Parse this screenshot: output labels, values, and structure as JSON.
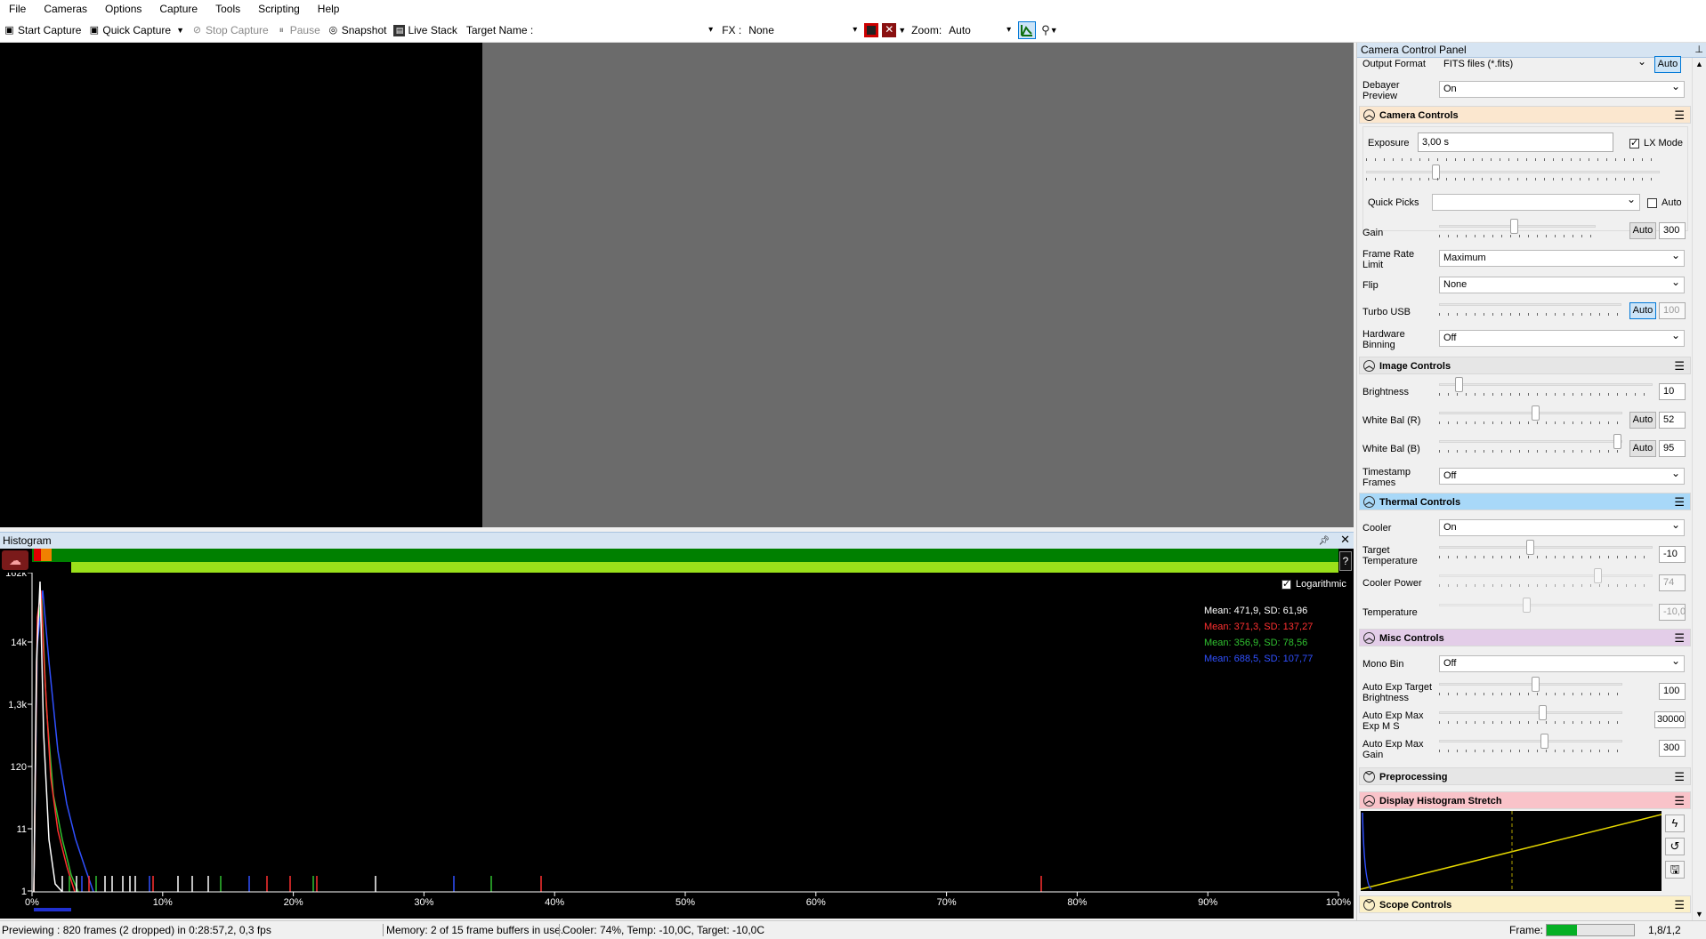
{
  "menu": [
    "File",
    "Cameras",
    "Options",
    "Capture",
    "Tools",
    "Scripting",
    "Help"
  ],
  "toolbar": {
    "start_capture": "Start Capture",
    "quick_capture": "Quick Capture",
    "stop_capture": "Stop Capture",
    "pause": "Pause",
    "snapshot": "Snapshot",
    "live_stack": "Live Stack",
    "target_name_label": "Target Name :",
    "target_name_value": "",
    "fx_label": "FX :",
    "fx_value": "None",
    "zoom_label": "Zoom:",
    "zoom_value": "Auto"
  },
  "histogram": {
    "title": "Histogram",
    "logarithmic_label": "Logarithmic",
    "logarithmic_checked": true,
    "y_ticks": [
      "162k",
      "14k",
      "1,3k",
      "120",
      "11",
      "1"
    ],
    "x_ticks": [
      "0%",
      "10%",
      "20%",
      "30%",
      "40%",
      "50%",
      "60%",
      "70%",
      "80%",
      "90%",
      "100%"
    ],
    "stats": [
      {
        "text": "Mean: 471,9, SD: 61,96",
        "color": "#ffffff"
      },
      {
        "text": "Mean: 371,3, SD: 137,27",
        "color": "#ff3030"
      },
      {
        "text": "Mean: 356,9, SD: 78,56",
        "color": "#30c030"
      },
      {
        "text": "Mean: 688,5, SD: 107,77",
        "color": "#3050ff"
      }
    ],
    "help": "?"
  },
  "status": {
    "previewing": "Previewing : 820 frames (2 dropped) in 0:28:57,2, 0,3 fps",
    "memory": "Memory: 2 of 15 frame buffers in use.",
    "cooler": "Cooler: 74%, Temp: -10,0C, Target: -10,0C",
    "frame_label": "Frame:",
    "frame_fill_fraction": 0.35,
    "frame_ratio": "1,8/1,2"
  },
  "panel": {
    "title": "Camera Control Panel",
    "output_format_label": "Output Format",
    "output_format_value": "FITS files (*.fits)",
    "output_format_auto": "Auto",
    "debayer_label": "Debayer\nPreview",
    "debayer_value": "On",
    "camera_controls": {
      "title": "Camera Controls",
      "exposure_label": "Exposure",
      "exposure_value": "3,00 s",
      "lx_mode_label": "LX Mode",
      "lx_mode_checked": true,
      "quick_picks_label": "Quick Picks",
      "quick_picks_value": "",
      "quick_picks_auto": "Auto"
    },
    "gain_label": "Gain",
    "gain_auto": "Auto",
    "gain_value": "300",
    "frame_rate_label": "Frame Rate\nLimit",
    "frame_rate_value": "Maximum",
    "flip_label": "Flip",
    "flip_value": "None",
    "turbo_label": "Turbo USB",
    "turbo_auto": "Auto",
    "turbo_value": "100",
    "hw_binning_label": "Hardware\nBinning",
    "hw_binning_value": "Off",
    "image_controls": {
      "title": "Image Controls",
      "brightness_label": "Brightness",
      "brightness_value": "10",
      "wb_r_label": "White Bal (R)",
      "wb_r_auto": "Auto",
      "wb_r_value": "52",
      "wb_b_label": "White Bal (B)",
      "wb_b_auto": "Auto",
      "wb_b_value": "95",
      "timestamp_label": "Timestamp\nFrames",
      "timestamp_value": "Off"
    },
    "thermal_controls": {
      "title": "Thermal Controls",
      "cooler_label": "Cooler",
      "cooler_value": "On",
      "target_temp_label": "Target\nTemperature",
      "target_temp_value": "-10",
      "cooler_power_label": "Cooler Power",
      "cooler_power_value": "74",
      "temperature_label": "Temperature",
      "temperature_value": "-10,0"
    },
    "misc_controls": {
      "title": "Misc Controls",
      "mono_bin_label": "Mono Bin",
      "mono_bin_value": "Off",
      "auto_exp_brightness_label": "Auto Exp Target\nBrightness",
      "auto_exp_brightness_value": "100",
      "auto_exp_max_ms_label": "Auto Exp Max\nExp M S",
      "auto_exp_max_ms_value": "30000",
      "auto_exp_max_gain_label": "Auto Exp Max\nGain",
      "auto_exp_max_gain_value": "300"
    },
    "preprocessing_title": "Preprocessing",
    "display_stretch_title": "Display Histogram Stretch",
    "scope_controls_title": "Scope Controls"
  },
  "colors": {
    "camera_section": "#fbe7cf",
    "image_section": "#e6e6e6",
    "thermal_section": "#a8d8f8",
    "misc_section": "#e3cde8",
    "pre_section": "#e6e6e6",
    "stretch_section": "#f9c3c9",
    "scope_section": "#fbf0c8"
  }
}
